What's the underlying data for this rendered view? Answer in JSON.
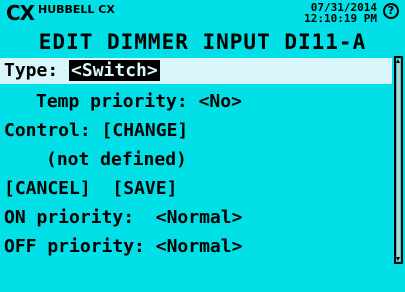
{
  "header": {
    "logo": "CX",
    "brand": "HUBBELL CX",
    "date": "07/31/2014",
    "time": "12:10:19 PM",
    "help_glyph": "?"
  },
  "title": "EDIT DIMMER INPUT DI11-A",
  "fields": {
    "type_label": "Type:",
    "type_value": "<Switch>",
    "temp_priority_label": "Temp priority:",
    "temp_priority_value": "<No>",
    "control_label": "Control:",
    "control_value": "[CHANGE]",
    "control_status": "(not defined)",
    "cancel": "[CANCEL]",
    "save": "[SAVE]",
    "on_priority_label": "ON priority:",
    "on_priority_value": "<Normal>",
    "off_priority_label": "OFF priority:",
    "off_priority_value": "<Normal>"
  },
  "colors": {
    "background": "#00e0e6",
    "highlight": "#d8f6fb",
    "text": "#000000"
  }
}
